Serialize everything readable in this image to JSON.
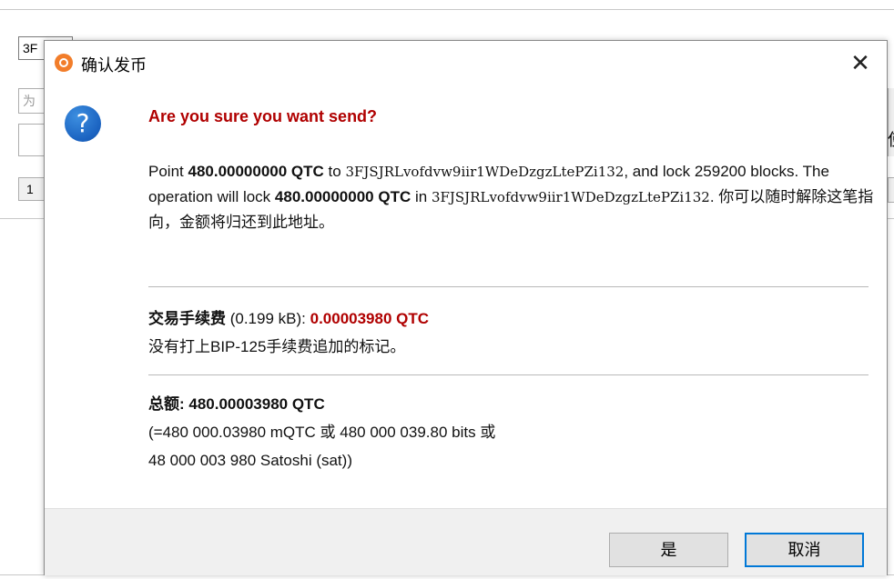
{
  "background": {
    "address_prefix": "3F",
    "label_placeholder": "为",
    "small_button": "1",
    "right_char": "使"
  },
  "dialog": {
    "title": "确认发币",
    "close_glyph": "✕",
    "icon_glyph": "?",
    "heading": "Are you sure you want send?",
    "body": {
      "point_prefix": "Point ",
      "amount": "480.00000000 QTC",
      "to_word": " to ",
      "address": "3FJSJRLvofdvw9iir1WDeDzgzLtePZi132",
      "lock_text": ", and lock 259200 blocks. The operation will lock ",
      "in_word": " in ",
      "address2": "3FJSJRLvofdvw9iir1WDeDzgzLtePZi132",
      "tail": ". 你可以随时解除这笔指向，金额将归还到此地址。"
    },
    "fee": {
      "label": "交易手续费",
      "size": " (0.199 kB): ",
      "value": "0.00003980 QTC",
      "note": "没有打上BIP-125手续费追加的标记。"
    },
    "total": {
      "label": "总额: 480.00003980 QTC",
      "line2": "(=480 000.03980 mQTC 或 480 000 039.80 bits 或",
      "line3": "48 000 003 980 Satoshi (sat))"
    },
    "buttons": {
      "yes": "是",
      "cancel": "取消"
    }
  }
}
